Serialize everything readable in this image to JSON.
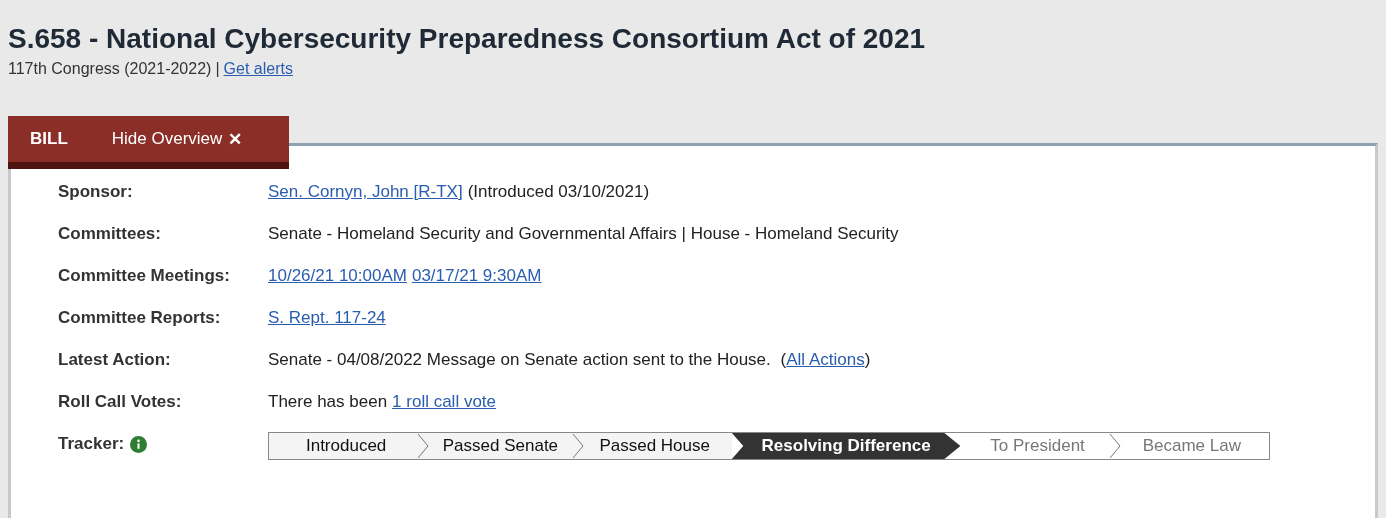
{
  "title": "S.658 - National Cybersecurity Preparedness Consortium Act of 2021",
  "subtitle": {
    "congress": "117th Congress (2021-2022)",
    "separator": "|",
    "link": "Get alerts"
  },
  "tabs": [
    {
      "label": "BILL",
      "selected": true
    },
    {
      "label": "Hide Overview",
      "icon": "✕",
      "selected": false
    }
  ],
  "overview": [
    {
      "label": "Sponsor:",
      "parts": [
        {
          "kind": "link",
          "text": "Sen. Cornyn, John [R-TX]"
        },
        {
          "kind": "text",
          "text": "(Introduced 03/10/2021)"
        }
      ]
    },
    {
      "label": "Committees:",
      "parts": [
        {
          "kind": "text",
          "text": "Senate - Homeland Security and Governmental Affairs | House - Homeland Security"
        }
      ]
    },
    {
      "label": "Committee Meetings:",
      "parts": [
        {
          "kind": "link",
          "text": "10/26/21 10:00AM"
        },
        {
          "kind": "link",
          "text": "03/17/21 9:30AM"
        }
      ]
    },
    {
      "label": "Committee Reports:",
      "parts": [
        {
          "kind": "link",
          "text": "S. Rept. 117-24"
        }
      ]
    },
    {
      "label": "Latest Action:",
      "parts": [
        {
          "kind": "text",
          "text": "Senate - 04/08/2022 Message on Senate action sent to the House. "
        },
        {
          "kind": "group",
          "parts": [
            {
              "kind": "text",
              "text": "("
            },
            {
              "kind": "link",
              "text": "All Actions"
            },
            {
              "kind": "text",
              "text": ")"
            }
          ]
        }
      ]
    },
    {
      "label": "Roll Call Votes:",
      "parts": [
        {
          "kind": "text",
          "text": "There has been"
        },
        {
          "kind": "link",
          "text": "1 roll call vote"
        }
      ]
    }
  ],
  "tracker": {
    "label": "Tracker:",
    "steps": [
      {
        "label": "Introduced",
        "completed": true,
        "current": false
      },
      {
        "label": "Passed Senate",
        "completed": true,
        "current": false
      },
      {
        "label": "Passed House",
        "completed": true,
        "current": false
      },
      {
        "label": "Resolving Difference",
        "completed": false,
        "current": true
      },
      {
        "label": "To President",
        "completed": false,
        "current": false
      },
      {
        "label": "Became Law",
        "completed": false,
        "current": false
      }
    ]
  }
}
